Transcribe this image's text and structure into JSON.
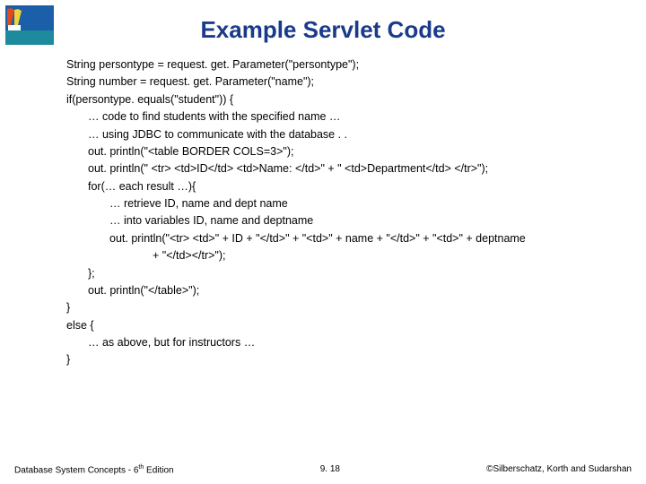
{
  "title": "Example Servlet Code",
  "code": {
    "l1": "String persontype = request. get. Parameter(\"persontype\");",
    "l2": "String number = request. get. Parameter(\"name\");",
    "l3": "if(persontype. equals(\"student\")) {",
    "l4": "… code to find students with the specified name …",
    "l5": "… using JDBC to communicate with the database . .",
    "l6": "out. println(\"<table BORDER COLS=3>\");",
    "l7": "out. println(\" <tr> <td>ID</td> <td>Name: </td>\" + \" <td>Department</td> </tr>\");",
    "l8": "for(… each result …){",
    "l9": "… retrieve ID, name and dept name",
    "l10": "… into variables ID, name and deptname",
    "l11": "out. println(\"<tr> <td>\" + ID + \"</td>\" + \"<td>\" + name + \"</td>\" + \"<td>\" + deptname",
    "l11b": "+ \"</td></tr>\");",
    "l12": "};",
    "l13": "out. println(\"</table>\");",
    "l14": "}",
    "l15": "else {",
    "l16": "… as above, but for instructors …",
    "l17": "}"
  },
  "footer": {
    "left_a": "Database System Concepts - 6",
    "left_b": " Edition",
    "left_sup": "th",
    "center": "9. 18",
    "right": "©Silberschatz, Korth and Sudarshan"
  }
}
